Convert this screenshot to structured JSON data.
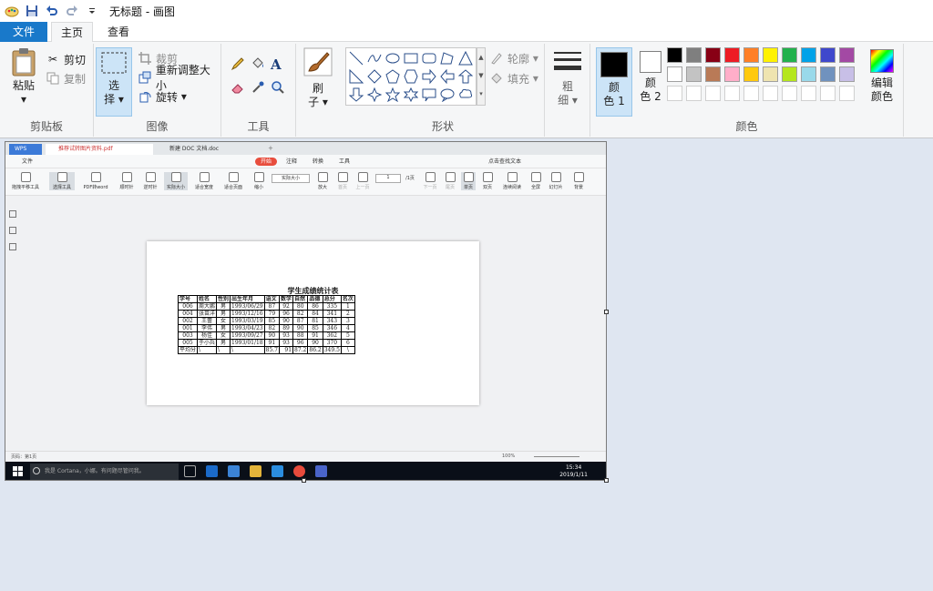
{
  "titlebar": {
    "title": "无标题 - 画图"
  },
  "tabs": [
    {
      "label": "文件"
    },
    {
      "label": "主页"
    },
    {
      "label": "查看"
    }
  ],
  "ribbon": {
    "clipboard": {
      "paste": "粘贴",
      "cut": "剪切",
      "copy": "复制",
      "group": "剪贴板"
    },
    "image": {
      "select_top": "选",
      "select_bottom": "择",
      "crop": "裁剪",
      "resize": "重新调整大小",
      "rotate": "旋转",
      "group": "图像"
    },
    "tools": {
      "group": "工具"
    },
    "shapes": {
      "outline": "轮廓",
      "fill": "填充",
      "brush_top": "刷",
      "brush_bottom": "子",
      "group": "形状"
    },
    "size": {
      "top": "粗",
      "bottom": "细"
    },
    "colors": {
      "color1_top": "颜",
      "color1_bottom": "色 1",
      "color2_top": "颜",
      "color2_bottom": "色 2",
      "edit_top": "编辑",
      "edit_bottom": "颜色",
      "group": "颜色",
      "color1": "#000000",
      "color2": "#ffffff",
      "palette": [
        "#000000",
        "#7f7f7f",
        "#880015",
        "#ed1c24",
        "#ff7f27",
        "#fff200",
        "#22b14c",
        "#00a2e8",
        "#3f48cc",
        "#a349a4",
        "#ffffff",
        "#c3c3c3",
        "#b97a57",
        "#ffaec9",
        "#ffc90e",
        "#efe4b0",
        "#b5e61d",
        "#99d9ea",
        "#7092be",
        "#c8bfe7",
        "#ffffff",
        "#ffffff",
        "#ffffff",
        "#ffffff",
        "#ffffff",
        "#ffffff",
        "#ffffff",
        "#ffffff",
        "#ffffff",
        "#ffffff"
      ]
    }
  },
  "pasted": {
    "wps_tabs": {
      "app": "WPS",
      "tab1": "推荐试转图片资料.pdf",
      "tab2": "新建 DOC 文档.doc"
    },
    "menu": {
      "file": "文件",
      "start": "开始",
      "annotate": "注释",
      "convert": "转换",
      "tools": "工具",
      "search": "点击查找文本",
      "login": "登录"
    },
    "toolbar": {
      "hand": "拖拽平移工具",
      "select": "选择工具",
      "pdf2word": "PDF转word",
      "rotate_left": "顺时针",
      "rotate_right": "逆时针",
      "actual": "实际大小",
      "fit_width": "适合宽度",
      "fit_page": "适合页面",
      "zoom_out": "缩小",
      "zoom_level": "实际大小",
      "zoom_in": "放大",
      "first": "首页",
      "prev": "上一页",
      "page": "1",
      "page_total": "/1页",
      "next": "下一页",
      "last": "尾页",
      "single": "单页",
      "double": "双页",
      "continuous": "连续阅读",
      "fullscreen": "全屏",
      "slideshow": "幻灯片",
      "background": "背景"
    },
    "doc": {
      "title": "学生成绩统计表",
      "headers": [
        "学号",
        "姓名",
        "性别",
        "出生年月",
        "语文",
        "数学",
        "自然",
        "品德",
        "总分",
        "名次"
      ],
      "rows": [
        [
          "006",
          "周大鹏",
          "男",
          "1993/06/29",
          "87",
          "92",
          "80",
          "86",
          "335",
          "1"
        ],
        [
          "004",
          "张苗洋",
          "男",
          "1993/12/16",
          "79",
          "96",
          "82",
          "84",
          "341",
          "2"
        ],
        [
          "002",
          "王蕾",
          "女",
          "1993/03/19",
          "85",
          "90",
          "87",
          "81",
          "343",
          "3"
        ],
        [
          "001",
          "李伟",
          "男",
          "1993/04/23",
          "82",
          "89",
          "90",
          "85",
          "346",
          "4"
        ],
        [
          "003",
          "杨佳",
          "女",
          "1993/09/27",
          "90",
          "93",
          "88",
          "91",
          "362",
          "5"
        ],
        [
          "005",
          "于小兵",
          "男",
          "1993/01/18",
          "91",
          "93",
          "96",
          "90",
          "370",
          "6"
        ]
      ],
      "average_row": [
        "平均分",
        "\\",
        "\\",
        "\\",
        "85.7",
        "91",
        "87.2",
        "86.2",
        "349.5",
        "\\"
      ]
    },
    "status": {
      "page_info": "页码：第1页",
      "zoom": "100%"
    },
    "taskbar": {
      "search": "我是 Cortana，小娜。有问题尽管问我。",
      "time": "15:34",
      "date": "2019/1/11"
    }
  }
}
